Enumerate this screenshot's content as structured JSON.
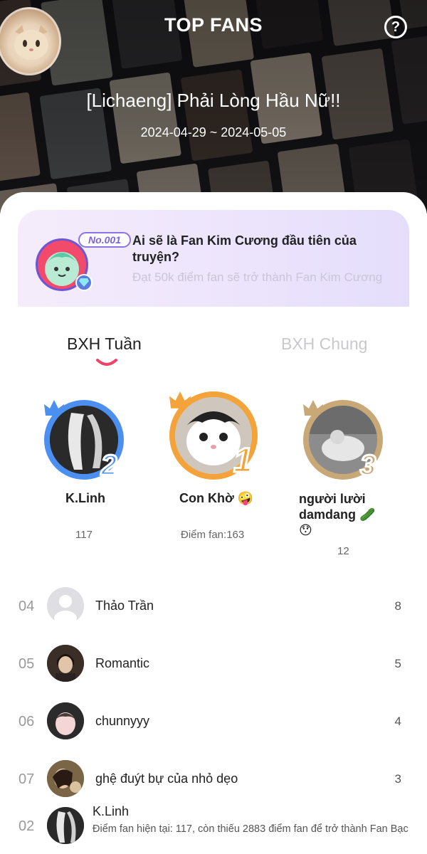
{
  "header": {
    "title": "TOP FANS",
    "help_icon": "?",
    "comic_title": "[Lichaeng] Phải Lòng Hầu Nữ!!",
    "date_range": "2024-04-29 ~ 2024-05-05"
  },
  "promo": {
    "badge": "No.001",
    "title": "Ai sẽ là Fan Kim Cương đầu tiên của truyện?",
    "subtitle": "Đạt 50k điểm fan sẽ trở thành Fan Kim Cương"
  },
  "tabs": {
    "weekly": "BXH Tuần",
    "general": "BXH Chung",
    "active": "weekly"
  },
  "podium": [
    {
      "rank": "2",
      "name": "K.Linh",
      "score": "117",
      "ring_color": "#4b8ff0"
    },
    {
      "rank": "1",
      "name": "Con Khờ 🤪",
      "score": "Điểm fan:163",
      "ring_color": "#f3a33a"
    },
    {
      "rank": "3",
      "name": "người lười damdang 🥒 😯",
      "score": "12",
      "ring_color": "#c9a877"
    }
  ],
  "list": [
    {
      "rank": "04",
      "name": "Thảo Trần",
      "score": "8"
    },
    {
      "rank": "05",
      "name": "Romantic",
      "score": "5"
    },
    {
      "rank": "06",
      "name": "chunnyyy",
      "score": "4"
    },
    {
      "rank": "07",
      "name": "ghệ đuýt bự của nhỏ dẹo",
      "score": "3"
    }
  ],
  "me": {
    "rank": "02",
    "name": "K.Linh",
    "description": "Điểm fan hiện tại: 117, còn thiếu 2883 điểm fan để trở thành Fan Bạc"
  }
}
